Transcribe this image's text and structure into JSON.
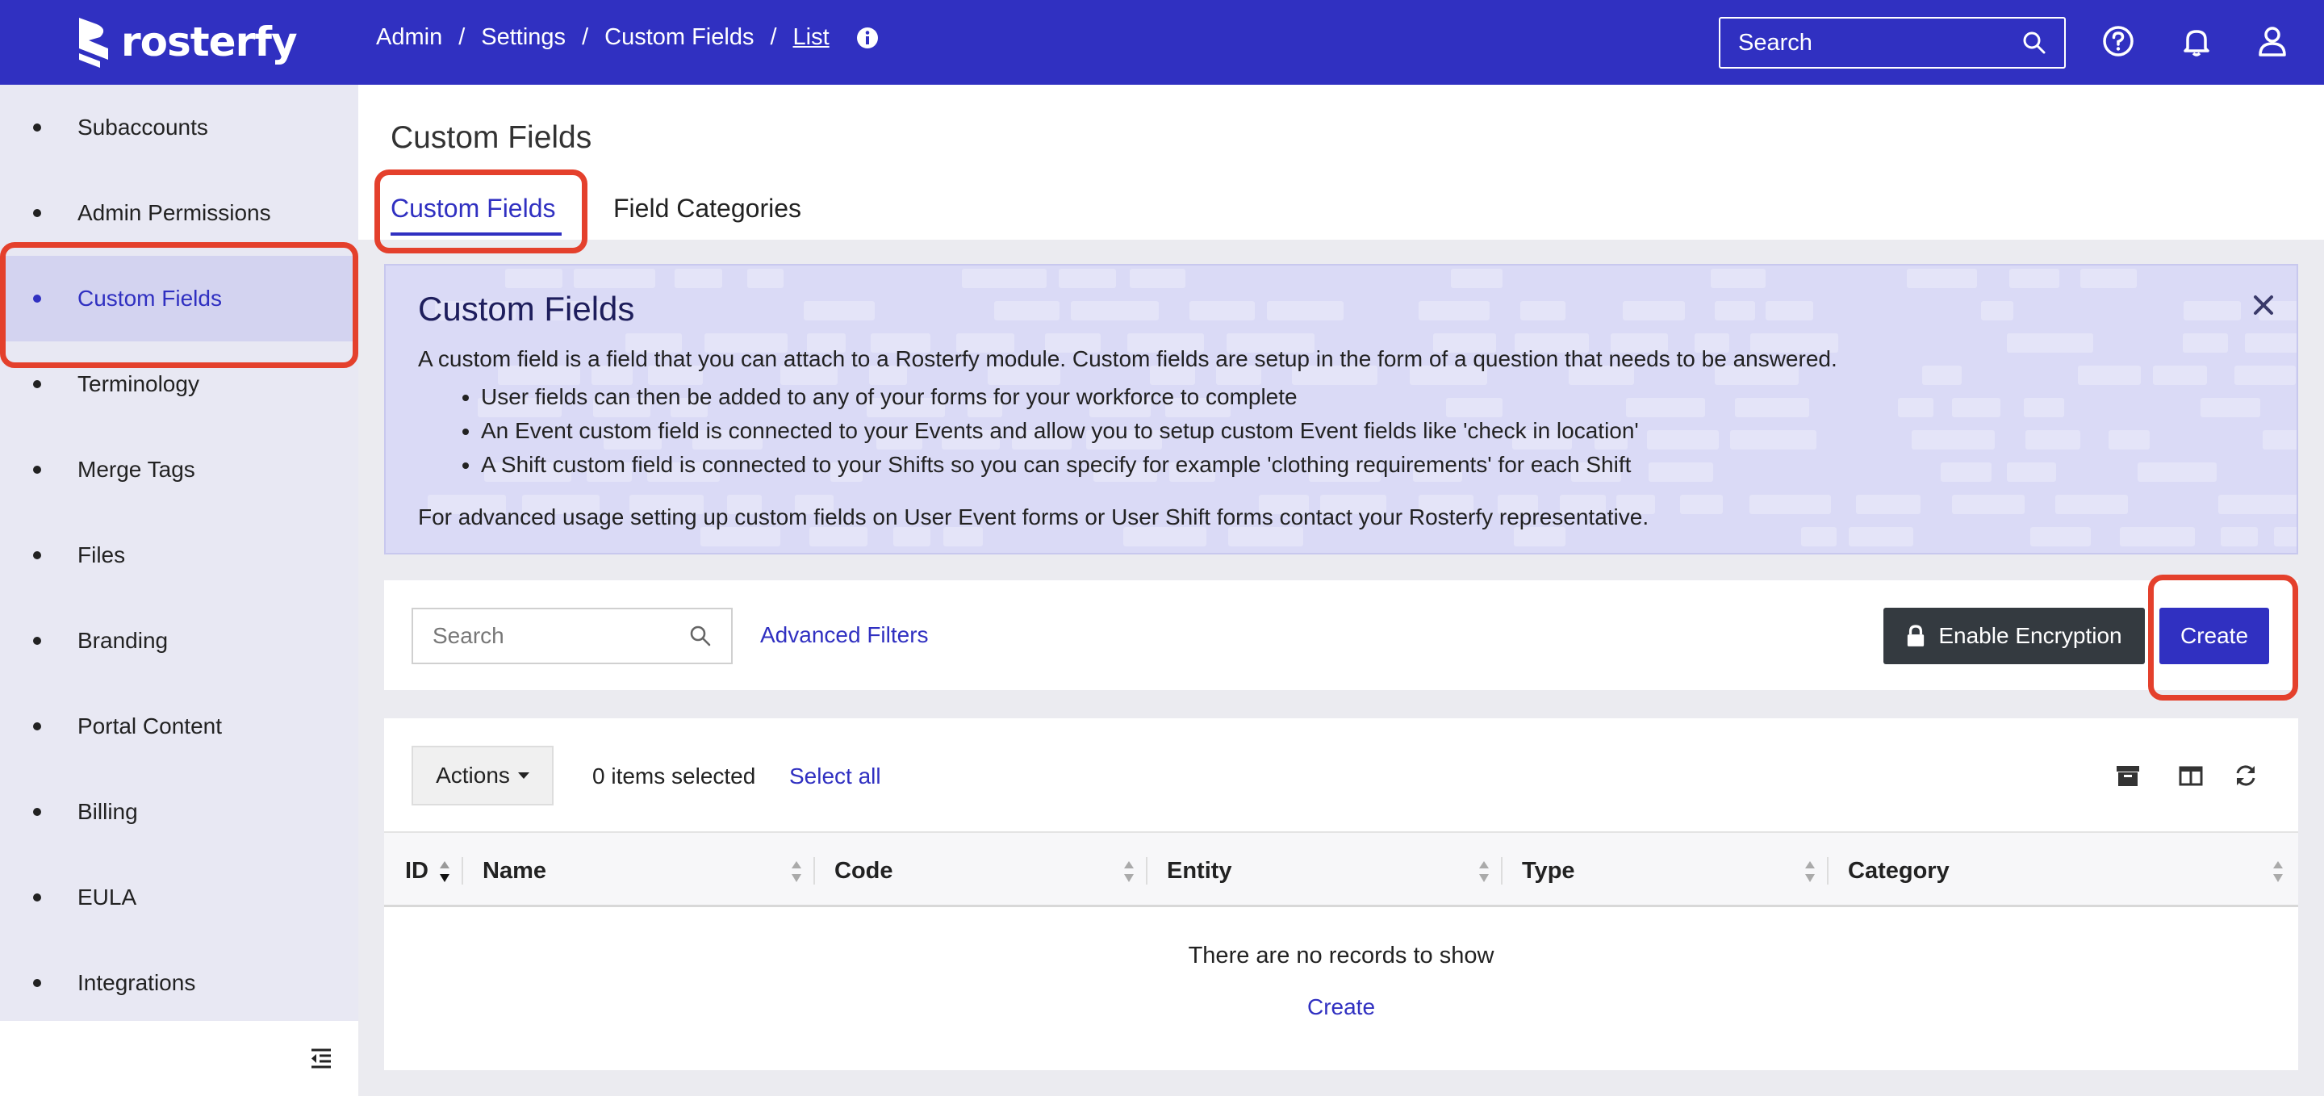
{
  "brand": {
    "name": "rosterfy",
    "accent": "#3030c1",
    "highlight": "#e4402c"
  },
  "breadcrumb": [
    "Admin",
    "Settings",
    "Custom Fields",
    "List"
  ],
  "topbar": {
    "search_placeholder": "Search",
    "icons": [
      "info-icon",
      "search-icon",
      "help-icon",
      "bell-icon",
      "user-icon"
    ]
  },
  "sidebar": {
    "items": [
      {
        "label": "Subaccounts",
        "active": false
      },
      {
        "label": "Admin Permissions",
        "active": false
      },
      {
        "label": "Custom Fields",
        "active": true
      },
      {
        "label": "Terminology",
        "active": false
      },
      {
        "label": "Merge Tags",
        "active": false
      },
      {
        "label": "Files",
        "active": false
      },
      {
        "label": "Branding",
        "active": false
      },
      {
        "label": "Portal Content",
        "active": false
      },
      {
        "label": "Billing",
        "active": false
      },
      {
        "label": "EULA",
        "active": false
      },
      {
        "label": "Integrations",
        "active": false
      }
    ]
  },
  "page": {
    "title": "Custom Fields",
    "tabs": [
      {
        "label": "Custom Fields",
        "active": true
      },
      {
        "label": "Field Categories",
        "active": false
      }
    ]
  },
  "info_panel": {
    "title": "Custom Fields",
    "description": "A custom field is a field that you can attach to a Rosterfy module. Custom fields are setup in the form of a question that needs to be answered.",
    "bullets": [
      "User fields can then be added to any of your forms for your workforce to complete",
      "An Event custom field is connected to your Events and allow you to setup custom Event fields like 'check in location'",
      "A Shift custom field is connected to your Shifts so you can specify for example 'clothing requirements' for each Shift"
    ],
    "note": "For advanced usage setting up custom fields on User Event forms or User Shift forms contact your Rosterfy representative."
  },
  "filters": {
    "search_placeholder": "Search",
    "advanced_filters_label": "Advanced Filters",
    "encrypt_label": "Enable Encryption",
    "create_label": "Create"
  },
  "table": {
    "actions_label": "Actions",
    "selected_text": "0 items selected",
    "select_all_label": "Select all",
    "columns": [
      "ID",
      "Name",
      "Code",
      "Entity",
      "Type",
      "Category"
    ],
    "empty_text": "There are no records to show",
    "empty_create_label": "Create"
  }
}
